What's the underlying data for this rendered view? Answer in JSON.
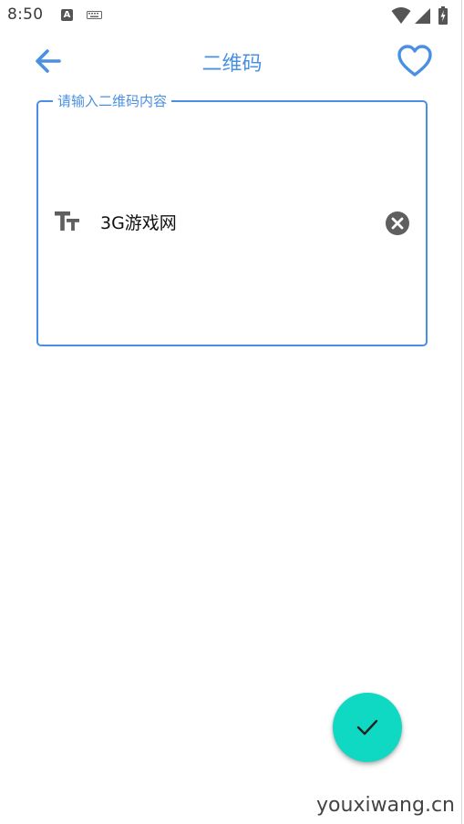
{
  "status_bar": {
    "time": "8:50",
    "icons": [
      "a-notification-icon",
      "keyboard-icon",
      "wifi-icon",
      "signal-icon",
      "battery-charging-icon"
    ]
  },
  "app_bar": {
    "title": "二维码",
    "back_icon": "arrow-left-icon",
    "favorite_icon": "heart-outline-icon"
  },
  "input": {
    "label": "请输入二维码内容",
    "value": "3G游戏网",
    "leading_icon": "text-format-icon",
    "trailing_icon": "clear-circle-icon"
  },
  "fab": {
    "icon": "check-icon"
  },
  "watermark": "youxiwang.cn",
  "colors": {
    "accent": "#4a90e2",
    "fab": "#0fd9c2",
    "icon_grey": "#5f5f5f"
  }
}
